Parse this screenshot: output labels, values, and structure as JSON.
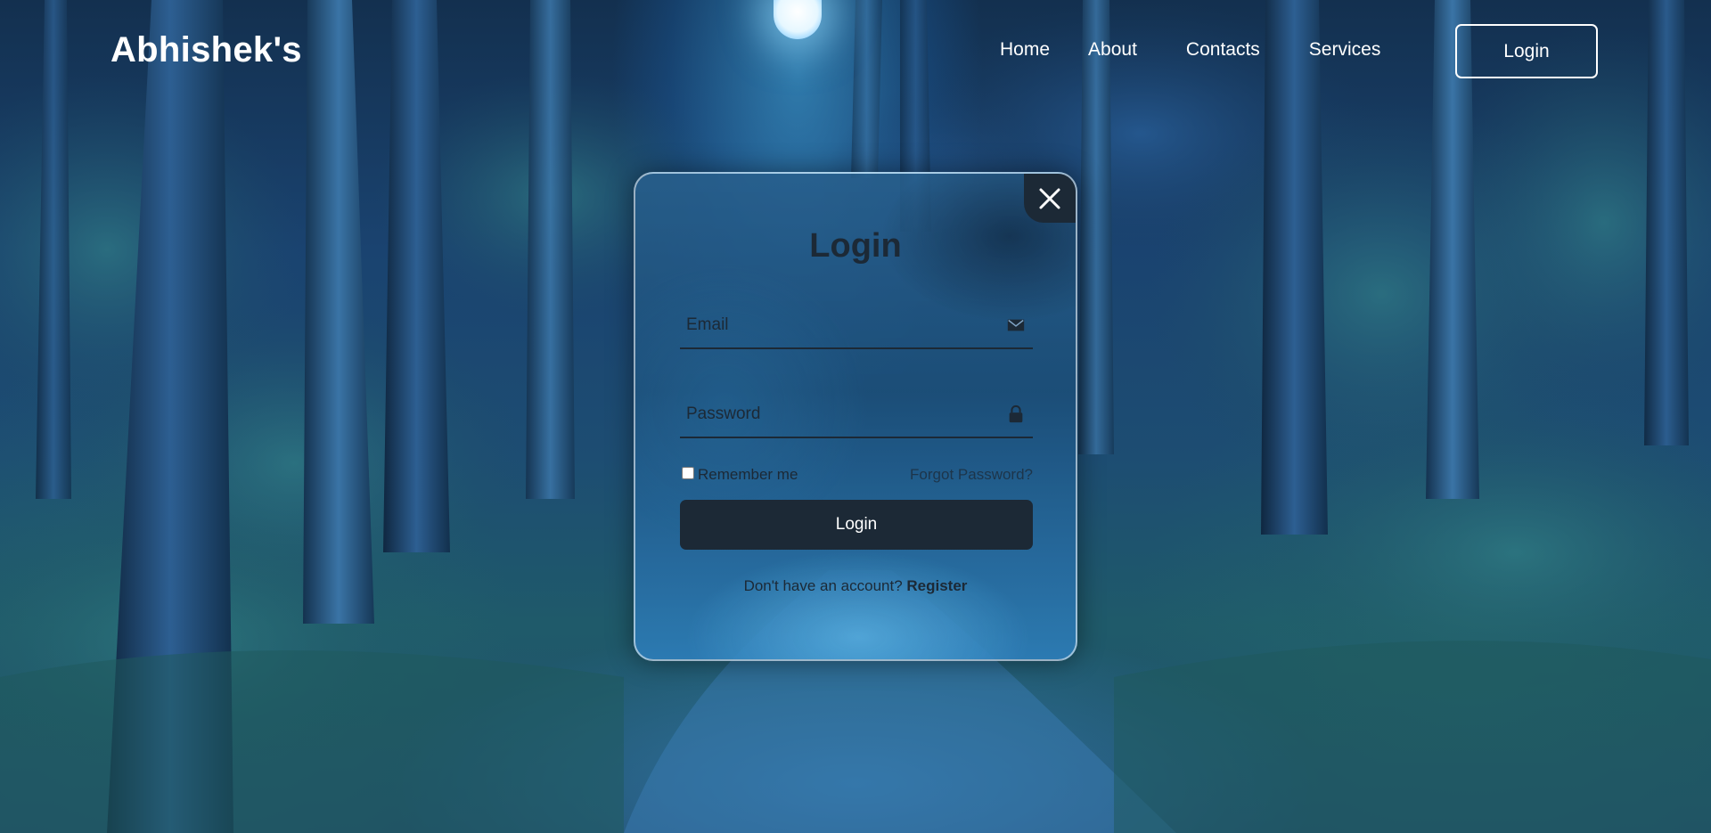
{
  "header": {
    "logo": "Abhishek's",
    "nav": {
      "home": "Home",
      "about": "About",
      "contacts": "Contacts",
      "services": "Services"
    },
    "login_button": "Login"
  },
  "popup": {
    "title": "Login",
    "email": {
      "placeholder": "Email",
      "value": "",
      "icon": "mail-icon"
    },
    "password": {
      "placeholder": "Password",
      "value": "",
      "icon": "lock-icon"
    },
    "remember_label": "Remember me",
    "remember_checked": false,
    "forgot_label": "Forgot Password?",
    "submit_label": "Login",
    "register_prompt": "Don't have an account?",
    "register_link": "Register",
    "close_icon": "close-icon"
  },
  "colors": {
    "dark": "#1c2936",
    "white": "#ffffff"
  }
}
